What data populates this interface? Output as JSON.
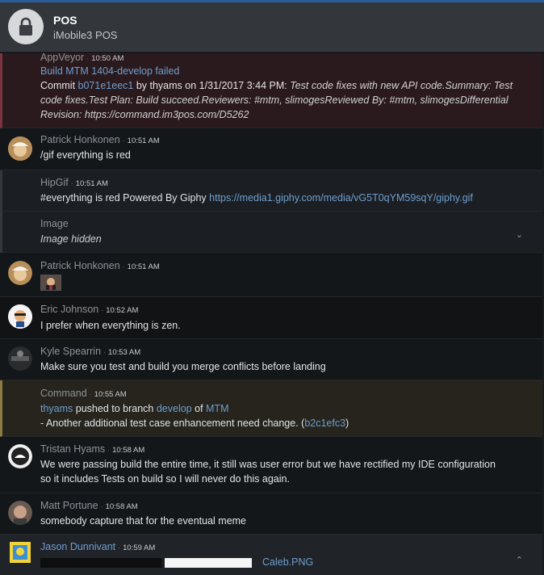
{
  "header": {
    "room_name": "POS",
    "room_topic": "iMobile3 POS",
    "icon": "lock-icon"
  },
  "messages": {
    "m1": {
      "author": "AppVeyor",
      "time": "10:50 AM",
      "title": "Build MTM 1404-develop failed",
      "commit_prefix": "Commit ",
      "commit_hash": "b071e1eec1",
      "commit_by": " by thyams on 1/31/2017 3:44 PM: ",
      "commit_msg_1": "Test code fixes with new API code.Summary: Test",
      "commit_msg_2": "code fixes.Test Plan: Build succeed.Reviewers: #mtm, slimogesReviewed By: #mtm, slimogesDifferential",
      "commit_msg_3": "Revision: https://command.im3pos.com/D5262"
    },
    "m2": {
      "author": "Patrick Honkonen",
      "time": "10:51 AM",
      "text": "/gif everything is red"
    },
    "m3": {
      "author": "HipGif",
      "time": "10:51 AM",
      "text": "#everything is red Powered By Giphy ",
      "link": "https://media1.giphy.com/media/vG5T0qYM59sqY/giphy.gif"
    },
    "m3b": {
      "label": "Image",
      "text": "Image hidden",
      "chevron": "⌄"
    },
    "m4": {
      "author": "Patrick Honkonen",
      "time": "10:51 AM"
    },
    "m5": {
      "author": "Eric Johnson",
      "time": "10:52 AM",
      "text": "I prefer when everything is zen."
    },
    "m6": {
      "author": "Kyle Spearrin",
      "time": "10:53 AM",
      "text": "Make sure you test and build you merge conflicts before landing"
    },
    "m7": {
      "author": "Command",
      "time": "10:55 AM",
      "user": "thyams",
      "pushed": " pushed to branch ",
      "branch": "develop",
      "of": " of ",
      "repo": "MTM",
      "line2": "- Another additional test case enhancement need change. (",
      "hash": "b2c1efc3",
      "close": ")"
    },
    "m8": {
      "author": "Tristan Hyams",
      "time": "10:58 AM",
      "line1": "We were passing build the entire time, it still was user error but we have rectified my IDE configuration",
      "line2": "so it includes Tests on build so I will never do this again."
    },
    "m9": {
      "author": "Matt Portune",
      "time": "10:58 AM",
      "text": "somebody capture that for the eventual meme"
    },
    "m10": {
      "author": "Jason Dunnivant",
      "time": "10:59 AM",
      "file": "Caleb.PNG",
      "chevron": "⌃"
    }
  },
  "colors": {
    "accent": "#2a5e98",
    "link": "#6f9fcf",
    "error_bg": "#2b1a1d",
    "command_bg": "#26241d"
  }
}
